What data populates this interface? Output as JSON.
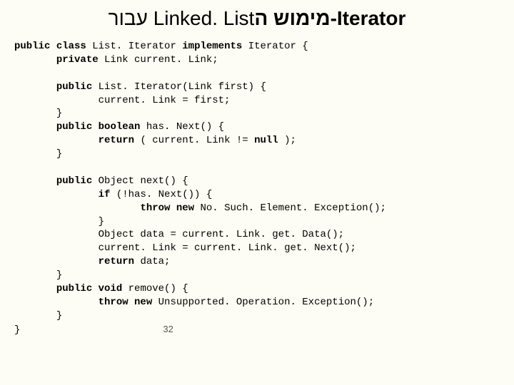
{
  "title": {
    "prefix_normal": "Linked. List עבור ",
    "bold_part": "Iterator-מימוש ה"
  },
  "code": {
    "l1_k1": "public",
    "l1_k2": "class",
    "l1_t1": " List. Iterator ",
    "l1_k3": "implements",
    "l1_t2": " Iterator {",
    "l2_k1": "private",
    "l2_t1": " Link current. Link;",
    "l3_k1": "public",
    "l3_t1": " List. Iterator(Link first) {",
    "l4": "current. Link = first;",
    "l5": "}",
    "l6_k1": "public",
    "l6_k2": "boolean",
    "l6_t1": " has. Next() {",
    "l7_k1": "return",
    "l7_t1": " ( current. Link != ",
    "l7_k2": "null",
    "l7_t2": " );",
    "l8": "}",
    "l9_k1": "public",
    "l9_t1": " Object next() {",
    "l10_k1": "if",
    "l10_t1": " (!has. Next()) {",
    "l11_k1": "throw new",
    "l11_t1": " No. Such. Element. Exception();",
    "l12": "}",
    "l13": "Object data = current. Link. get. Data();",
    "l14": "current. Link = current. Link. get. Next();",
    "l15_k1": "return",
    "l15_t1": " data;",
    "l16": "}",
    "l17_k1": "public",
    "l17_k2": "void",
    "l17_t1": " remove() {",
    "l18_k1": "throw new",
    "l18_t1": " Unsupported. Operation. Exception();",
    "l19": "}",
    "l20": "}"
  },
  "page_number": "32"
}
